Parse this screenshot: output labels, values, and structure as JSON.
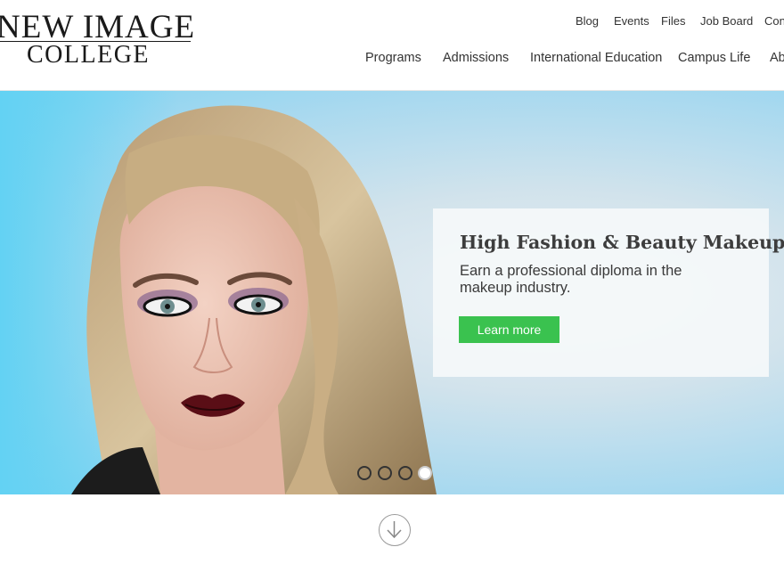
{
  "logo": {
    "line1": "NEW IMAGE",
    "line2": "COLLEGE"
  },
  "utility_nav": [
    "Blog",
    "Events",
    "Files",
    "Job Board",
    "Con"
  ],
  "main_nav": [
    "Programs",
    "Admissions",
    "International Education",
    "Campus Life",
    "Ab"
  ],
  "hero": {
    "title": "High Fashion & Beauty Makeup",
    "subtitle": "Earn a professional diploma in the makeup industry.",
    "cta_label": "Learn more",
    "slide_count": 4,
    "active_slide": 4
  },
  "colors": {
    "cta": "#3ac24f",
    "hero_sky": "#7fd3f2",
    "text": "#333333"
  },
  "icons": {
    "scroll": "arrow-down-circle-icon"
  }
}
